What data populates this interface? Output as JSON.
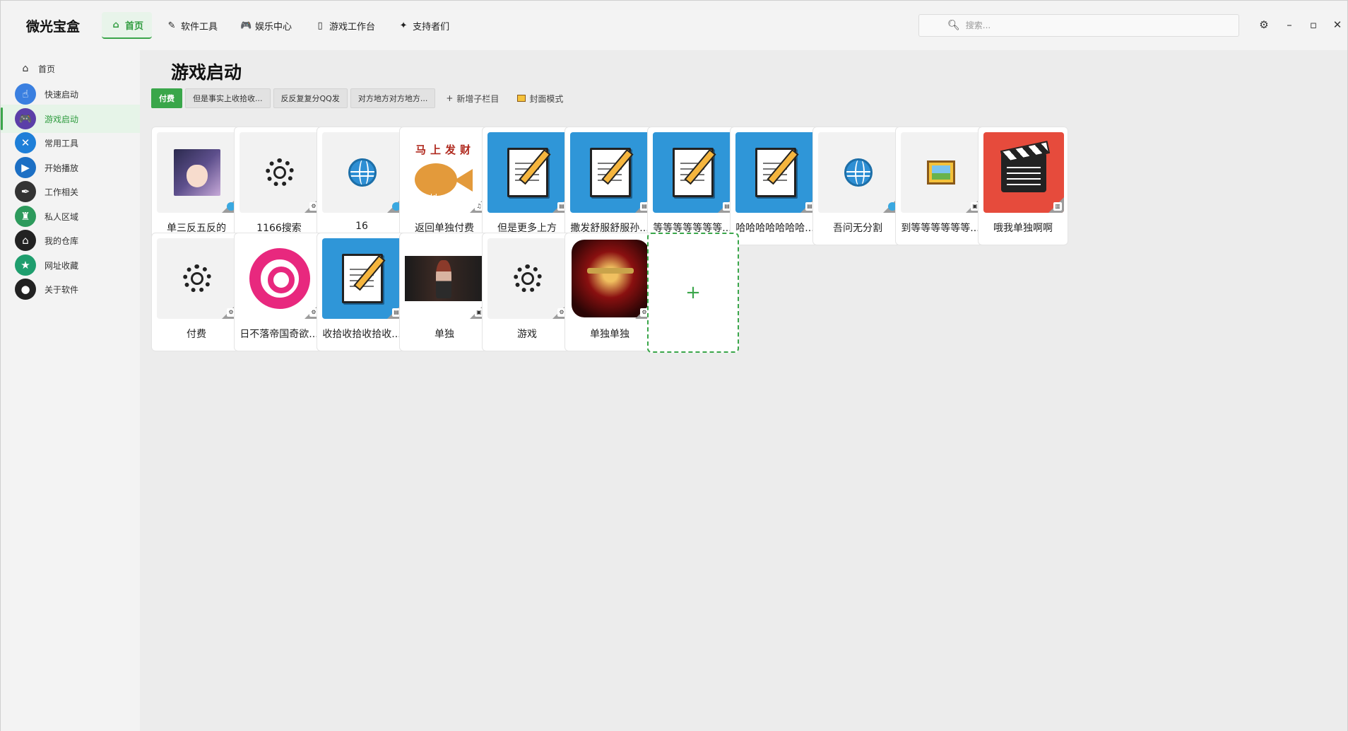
{
  "app": {
    "title": "微光宝盒"
  },
  "topnav": [
    {
      "label": "首页",
      "icon": "home-icon",
      "glyph": "⌂"
    },
    {
      "label": "软件工具",
      "icon": "pencil-icon",
      "glyph": "✎"
    },
    {
      "label": "娱乐中心",
      "icon": "gamepad-icon",
      "glyph": "🎮"
    },
    {
      "label": "游戏工作台",
      "icon": "document-icon",
      "glyph": "▯"
    },
    {
      "label": "支持者们",
      "icon": "star-icon",
      "glyph": "✦"
    }
  ],
  "search": {
    "placeholder": "搜索..."
  },
  "sidebar": [
    {
      "label": "首页",
      "icon": "home-icon",
      "glyph": "⌂",
      "color": ""
    },
    {
      "label": "快速启动",
      "icon": "pointer-hand-icon",
      "glyph": "☝",
      "color": "#3a7fe0"
    },
    {
      "label": "游戏启动",
      "icon": "gamepad-icon",
      "glyph": "🎮",
      "color": "#5b3fa8"
    },
    {
      "label": "常用工具",
      "icon": "tools-icon",
      "glyph": "✕",
      "color": "#1e7fd8"
    },
    {
      "label": "开始播放",
      "icon": "tv-play-icon",
      "glyph": "▶",
      "color": "#1c6fc4"
    },
    {
      "label": "工作相关",
      "icon": "feather-icon",
      "glyph": "✒",
      "color": "#333333"
    },
    {
      "label": "私人区域",
      "icon": "person-block-icon",
      "glyph": "♜",
      "color": "#2d9a5c"
    },
    {
      "label": "我的仓库",
      "icon": "warehouse-icon",
      "glyph": "⌂",
      "color": "#222222"
    },
    {
      "label": "网址收藏",
      "icon": "bookmark-star-icon",
      "glyph": "★",
      "color": "#1f9e6e"
    },
    {
      "label": "关于软件",
      "icon": "github-icon",
      "glyph": "●",
      "color": "#222222"
    }
  ],
  "page": {
    "title": "游戏启动"
  },
  "tabs": [
    "付费",
    "但是事实上收拾收...",
    "反反复复分QQ发",
    "对方地方对方地方..."
  ],
  "tab_actions": {
    "add_label": "新增子栏目",
    "cover_label": "封面模式"
  },
  "cards": [
    {
      "label": "单三反五反的",
      "art": "avatar",
      "badge": "web"
    },
    {
      "label": "1166搜索",
      "art": "gear",
      "badge": "app"
    },
    {
      "label": "16",
      "art": "globe",
      "badge": "web"
    },
    {
      "label": "返回单独付费",
      "art": "fish",
      "badge": "music"
    },
    {
      "label": "但是更多上方",
      "art": "doc",
      "badge": "file"
    },
    {
      "label": "撒发舒服舒服孙...",
      "art": "doc",
      "badge": "file"
    },
    {
      "label": "等等等等等等等...",
      "art": "doc",
      "badge": "file"
    },
    {
      "label": "哈哈哈哈哈哈哈...",
      "art": "doc",
      "badge": "file"
    },
    {
      "label": "吾问无分割",
      "art": "globe",
      "badge": "web"
    },
    {
      "label": "到等等等等等等...",
      "art": "picture",
      "badge": "image"
    },
    {
      "label": "哦我单独啊啊",
      "art": "clapper",
      "badge": "video"
    },
    {
      "label": "付费",
      "art": "gear",
      "badge": "app"
    },
    {
      "label": "日不落帝国奇欲...",
      "art": "swirl",
      "badge": "app"
    },
    {
      "label": "收拾收拾收拾收...",
      "art": "doc",
      "badge": "file"
    },
    {
      "label": "单独",
      "art": "photo",
      "badge": "image"
    },
    {
      "label": "游戏",
      "art": "gear",
      "badge": "app"
    },
    {
      "label": "单独单独",
      "art": "game",
      "badge": "app"
    }
  ],
  "fish_art": {
    "title": "马上发财",
    "url": "updd.cc"
  },
  "add_card": {
    "label": "+"
  },
  "window": {
    "settings_glyph": "⚙",
    "minimize_glyph": "–",
    "maximize_glyph": "▫",
    "close_glyph": "✕"
  },
  "colors": {
    "accent": "#3aa64a",
    "doc_blue": "#2f96d8",
    "clapper_red": "#e64b3c"
  }
}
